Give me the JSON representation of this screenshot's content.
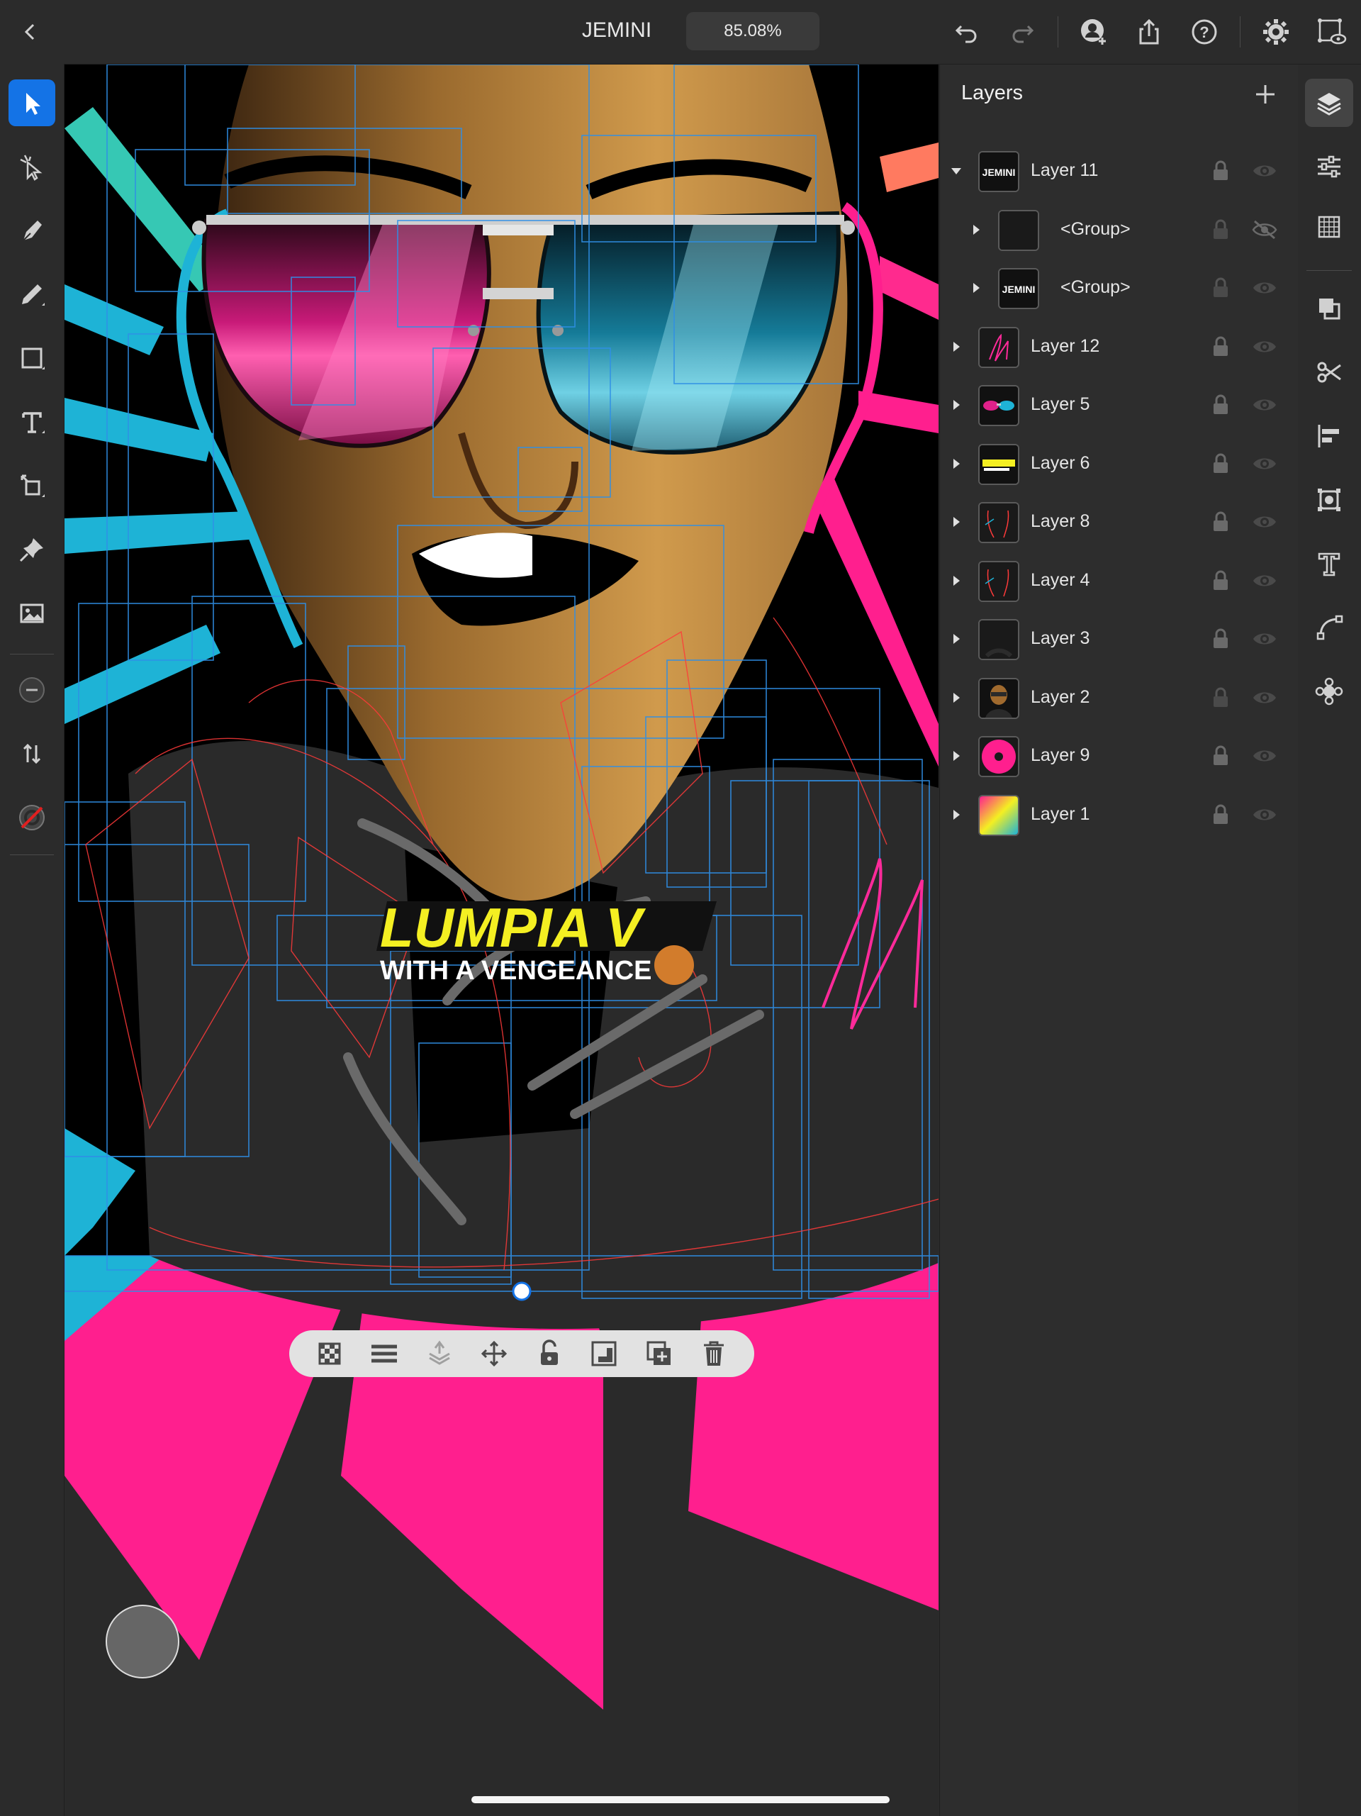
{
  "top_bar": {
    "back_icon": "chevron-left-icon",
    "doc_title": "JEMINI",
    "zoom": "85.08%",
    "icons": [
      "undo-icon",
      "redo-icon",
      "invite-user-icon",
      "share-icon",
      "help-icon",
      "settings-icon",
      "preview-icon"
    ]
  },
  "left_tools": [
    "selection-tool-icon",
    "direct-selection-tool-icon",
    "pen-tool-icon",
    "pencil-tool-icon",
    "rectangle-tool-icon",
    "type-tool-icon",
    "transform-tool-icon",
    "pin-icon",
    "image-icon",
    "stroke-width-icon",
    "swap-icon",
    "fill-stroke-icon"
  ],
  "layers_panel": {
    "title": "Layers",
    "add_icon": "plus-icon",
    "layers": [
      {
        "name": "Layer 11",
        "expanded": true,
        "thumb": "jemini"
      },
      {
        "name": "<Group>",
        "child": true,
        "thumb": "empty",
        "hidden": true
      },
      {
        "name": "<Group>",
        "child": true,
        "thumb": "jemini"
      },
      {
        "name": "Layer 12",
        "thumb": "signature"
      },
      {
        "name": "Layer 5",
        "thumb": "glasses"
      },
      {
        "name": "Layer 6",
        "thumb": "lumpia"
      },
      {
        "name": "Layer 8",
        "thumb": "lines"
      },
      {
        "name": "Layer 4",
        "thumb": "lines"
      },
      {
        "name": "Layer 3",
        "thumb": "dark"
      },
      {
        "name": "Layer 2",
        "thumb": "portrait"
      },
      {
        "name": "Layer 9",
        "thumb": "pink-burst"
      },
      {
        "name": "Layer 1",
        "thumb": "gradient"
      }
    ]
  },
  "right_strip": [
    "layers-icon",
    "properties-icon",
    "grid-icon",
    "combine-icon",
    "cut-icon",
    "align-icon",
    "repeat-grid-icon",
    "text-settings-icon",
    "path-icon",
    "effects-icon"
  ],
  "canvas": {
    "art_text_line1": "LUMPIA V",
    "art_text_line2": "WITH A VENGEANCE",
    "floating_toolbar": [
      "opacity-icon",
      "blend-mode-icon",
      "arrange-icon",
      "move-icon",
      "lock-icon",
      "mask-icon",
      "duplicate-icon",
      "delete-icon"
    ]
  },
  "colors": {
    "accent": "#1473e6",
    "pink": "#ff1f8e",
    "cyan": "#1eb3d6",
    "skin": "#c9893a",
    "yellow": "#f4ef22"
  }
}
